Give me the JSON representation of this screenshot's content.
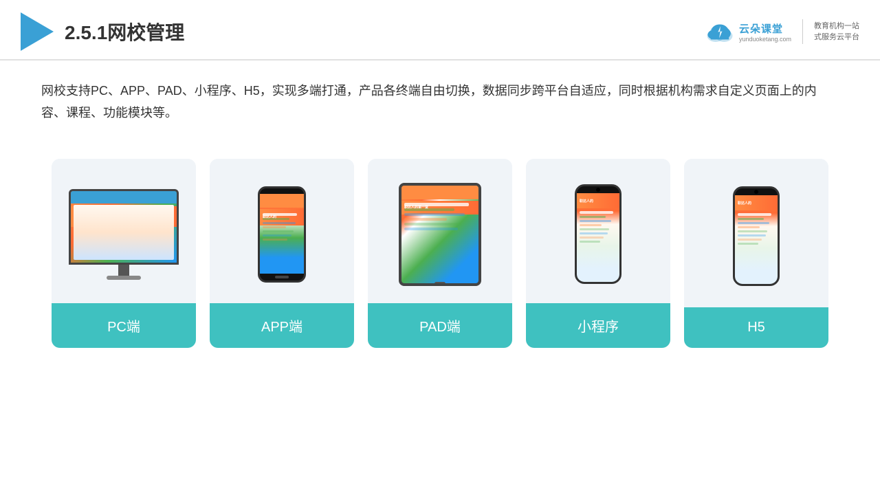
{
  "header": {
    "title": "2.5.1网校管理",
    "logo_main": "云朵课堂",
    "logo_url": "yunduoketang.com",
    "slogan_line1": "教育机构一站",
    "slogan_line2": "式服务云平台"
  },
  "description": {
    "text": "网校支持PC、APP、PAD、小程序、H5，实现多端打通，产品各终端自由切换，数据同步跨平台自适应，同时根据机构需求自定义页面上的内容、课程、功能模块等。"
  },
  "cards": [
    {
      "id": "pc",
      "label": "PC端"
    },
    {
      "id": "app",
      "label": "APP端"
    },
    {
      "id": "pad",
      "label": "PAD端"
    },
    {
      "id": "miniprogram",
      "label": "小程序"
    },
    {
      "id": "h5",
      "label": "H5"
    }
  ],
  "colors": {
    "teal": "#3fc1c0",
    "blue": "#3aa0d5",
    "bg_card": "#f0f4f8",
    "text_dark": "#333333"
  }
}
